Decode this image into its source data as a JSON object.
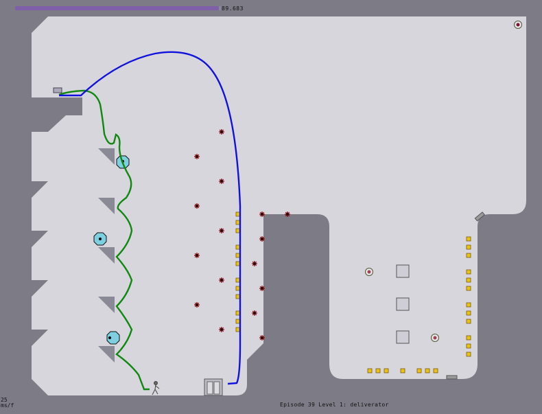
{
  "hud": {
    "time_value": "89.683",
    "time_fraction": 0.99,
    "fps_value": "25",
    "fps_unit": "ms/f",
    "level_label": "Episode 39 Level 1: deliverator"
  },
  "colors": {
    "background": "#7c7b86",
    "floor": "#d7d6dc",
    "wall": "#7c7b86",
    "time_bar": "#7f5fa8",
    "gold": "#e8c21a",
    "mine": "#8b0d0d",
    "drone": "#7ecfe0",
    "path_blue": "#1111dd",
    "path_green": "#118811"
  },
  "entities": {
    "gold_count": 42,
    "mine_count": 18,
    "drone_count": 3,
    "turret_count": 3
  }
}
